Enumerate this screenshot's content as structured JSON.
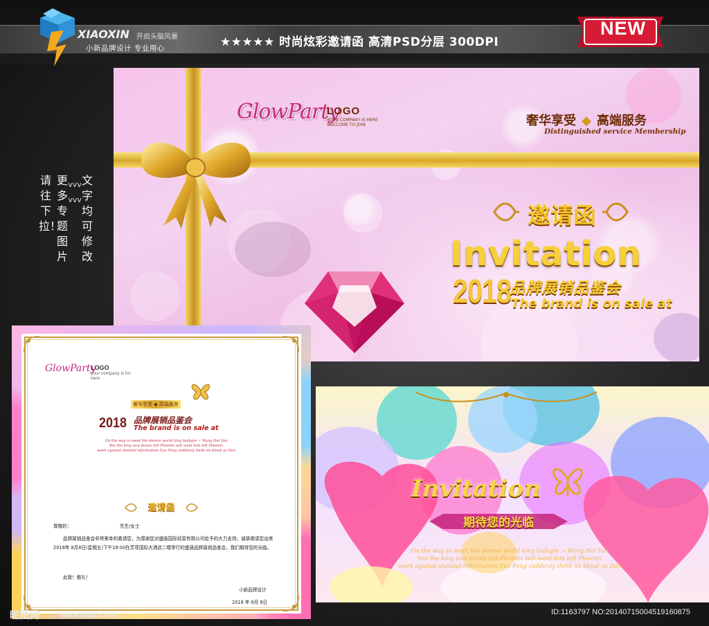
{
  "header": {
    "brand_en": "XIAOXIN",
    "brand_tag": "开启头脑风暴",
    "brand_cn": "小新品牌设计  专业用心",
    "headline": "★★★★★ 时尚炫彩邀请函   高清PSD分层   300DPI",
    "badge": "NEW"
  },
  "side_text": {
    "col_left": "请往下拉！",
    "col_mid": "更多专题图片",
    "col_mid_arrows": "vvvvvv",
    "col_right": "文字均可修改"
  },
  "main_card": {
    "party_logo": "GlowParty",
    "logo": "LOGO",
    "logo_sub": "YOUR COMPANY IS HERE  WELCOME TO JOIN",
    "lux_left": "奢华享受",
    "lux_right": "高端服务",
    "lux_sub": "Distinguished service Membership",
    "title_cn": "邀请函",
    "title_en": "Invitation",
    "year": "2018",
    "event_cn": "品牌展销品鉴会",
    "event_en": "The brand is on sale at"
  },
  "balloon_card": {
    "title_en": "Invitation",
    "subtitle_cn": "期待您的光临",
    "verse": [
      "On the way to meet the demon world king bufegin ~ Wang Hei Yan",
      "Yen the king saw bones left Phoenix will want him left Phoenix",
      "week against skeletal information Zuo Feng suddenly think its blood as Dan"
    ]
  },
  "letter_card": {
    "party_logo": "GlowParty",
    "logo": "LOGO",
    "logo_sub": "your company is for here",
    "lux": "奢华享受 ◆ 高端服务",
    "year": "2018",
    "event_cn": "品牌展销品鉴会",
    "event_en": "The brand is on sale at",
    "verse": [
      "On the way to meet the demon world king bufegin ~ Wang Hei Yan",
      "Yen the king saw bones left Phoenix will want him left Phoenix",
      "week against skeletal information Zuo Feng suddenly think its blood as Dan"
    ],
    "title_cn": "邀请函",
    "salutation": "尊敬的：",
    "title_gender": "先生/女士",
    "body": "品牌展销品鉴会非常荣幸的邀请您，为感谢您对盛唐国际经营有限公司给予的大力支持，诚挚邀请您出席2018年 8月8日(星期五)下午18:00在芳菲国际大酒店二楼举行的盛唐品牌展销品鉴会，我们期待您的光临。",
    "closing": "此致！敬礼！",
    "sign": "小新品牌设计",
    "date": "2018 年 8月 8日"
  },
  "footer": {
    "watermark": "昵图网",
    "url": "www.nipic.com",
    "id_text": "ID:1163797 NO:20140715004519160875"
  },
  "colors": {
    "gold": "#f4c63a",
    "pink_bg": "#f6c3ea",
    "badge_red": "#c8102e",
    "text_brown": "#6d2a04"
  }
}
